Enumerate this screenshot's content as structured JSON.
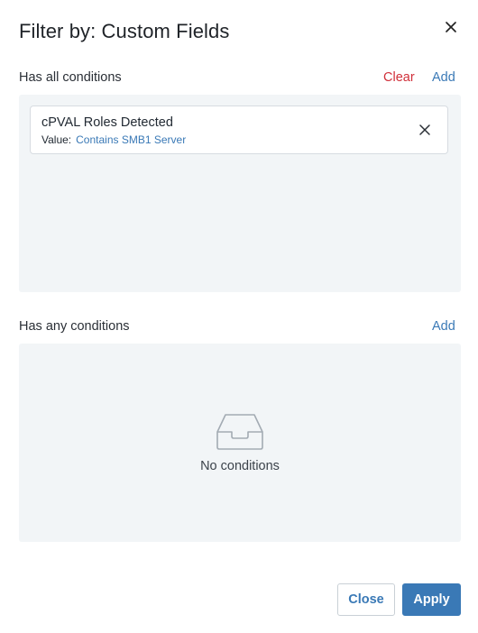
{
  "dialog": {
    "title": "Filter by: Custom Fields",
    "close_icon": "close-icon"
  },
  "all_conditions": {
    "label": "Has all conditions",
    "clear_label": "Clear",
    "add_label": "Add",
    "conditions": [
      {
        "name": "cPVAL Roles Detected",
        "value_key": "Value:",
        "value_text": "Contains SMB1 Server",
        "remove_icon": "close-icon"
      }
    ]
  },
  "any_conditions": {
    "label": "Has any conditions",
    "add_label": "Add",
    "empty_icon": "inbox-icon",
    "empty_text": "No conditions"
  },
  "footer": {
    "close_label": "Close",
    "apply_label": "Apply"
  },
  "colors": {
    "accent": "#3a79b6",
    "danger": "#d0303a",
    "panel_bg": "#f2f5f7"
  }
}
